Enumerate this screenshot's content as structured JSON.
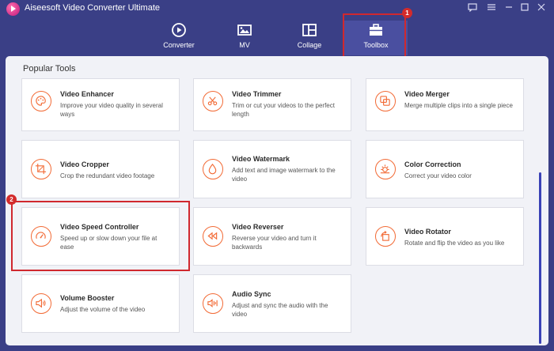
{
  "app": {
    "title": "Aiseesoft Video Converter Ultimate"
  },
  "nav": {
    "tabs": [
      {
        "label": "Converter",
        "icon": "converter-icon"
      },
      {
        "label": "MV",
        "icon": "mv-icon"
      },
      {
        "label": "Collage",
        "icon": "collage-icon"
      },
      {
        "label": "Toolbox",
        "icon": "toolbox-icon",
        "active": true
      }
    ]
  },
  "annotations": {
    "badge1": "1",
    "badge2": "2",
    "highlight_color": "#d0282e"
  },
  "section": {
    "title": "Popular Tools"
  },
  "tools": [
    {
      "name": "Video Enhancer",
      "desc": "Improve your video quality in several ways",
      "icon": "palette-icon"
    },
    {
      "name": "Video Trimmer",
      "desc": "Trim or cut your videos to the perfect length",
      "icon": "scissors-icon"
    },
    {
      "name": "Video Merger",
      "desc": "Merge multiple clips into a single piece",
      "icon": "merge-icon"
    },
    {
      "name": "Video Cropper",
      "desc": "Crop the redundant video footage",
      "icon": "crop-icon"
    },
    {
      "name": "Video Watermark",
      "desc": "Add text and image watermark to the video",
      "icon": "droplet-icon"
    },
    {
      "name": "Color Correction",
      "desc": "Correct your video color",
      "icon": "sun-icon"
    },
    {
      "name": "Video Speed Controller",
      "desc": "Speed up or slow down your file at ease",
      "icon": "speedometer-icon"
    },
    {
      "name": "Video Reverser",
      "desc": "Reverse your video and turn it backwards",
      "icon": "rewind-icon"
    },
    {
      "name": "Video Rotator",
      "desc": "Rotate and flip the video as you like",
      "icon": "rotate-icon"
    },
    {
      "name": "Volume Booster",
      "desc": "Adjust the volume of the video",
      "icon": "volume-icon"
    },
    {
      "name": "Audio Sync",
      "desc": "Adjust and sync the audio with the video",
      "icon": "audio-sync-icon"
    }
  ],
  "colors": {
    "accent": "#f26a35",
    "titlebar": "#3a3f86",
    "active_tab": "#4a4fa0"
  }
}
